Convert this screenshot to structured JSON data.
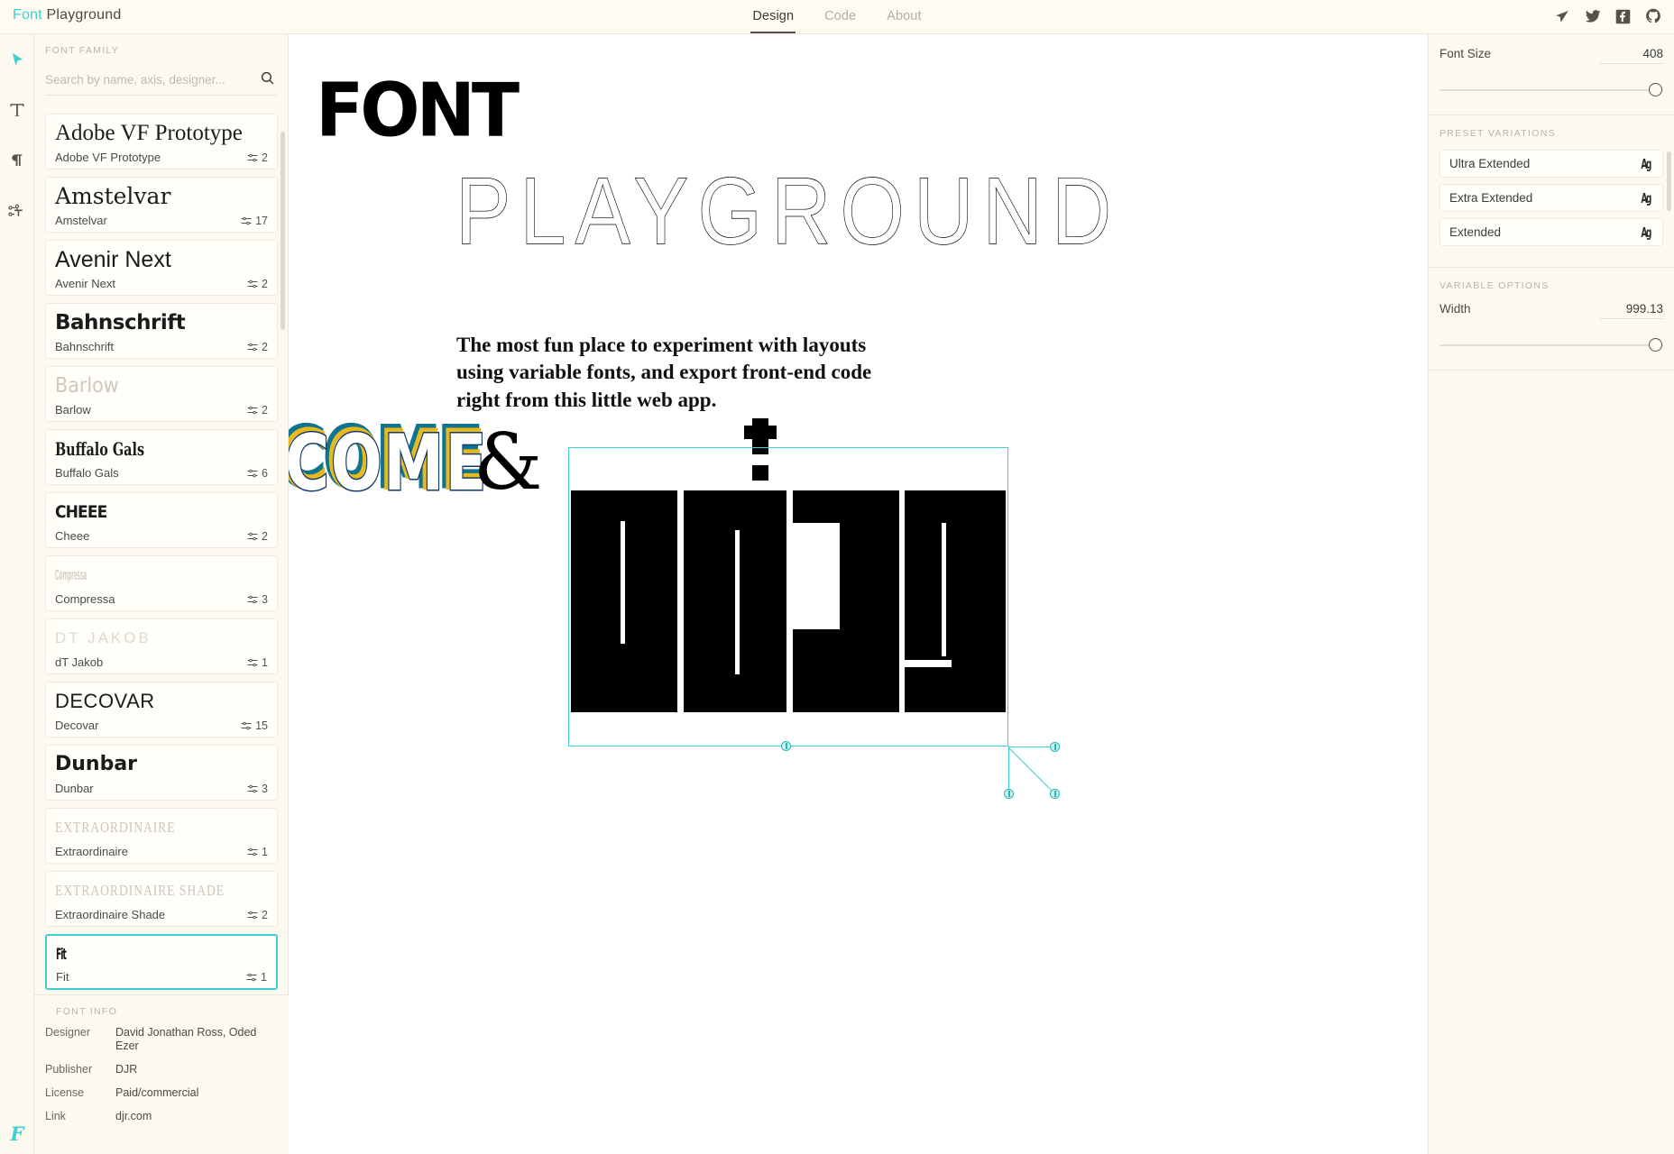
{
  "app": {
    "brand_accent": "Font",
    "brand_rest": " Playground",
    "accent_color": "#3ecfcf",
    "logo_letter": "F"
  },
  "header": {
    "tabs": [
      {
        "label": "Design",
        "active": true
      },
      {
        "label": "Code",
        "active": false
      },
      {
        "label": "About",
        "active": false
      }
    ],
    "icons": [
      "cursor-icon",
      "twitter-icon",
      "facebook-icon",
      "github-icon"
    ]
  },
  "toolrail": {
    "tools": [
      {
        "name": "select-tool",
        "icon": "cursor-icon",
        "active": true
      },
      {
        "name": "text-tool",
        "icon": "text-t-icon",
        "active": false
      },
      {
        "name": "paragraph-tool",
        "icon": "pilcrow-icon",
        "active": false
      },
      {
        "name": "glyph-node-tool",
        "icon": "glyph-nodes-icon",
        "active": false
      }
    ]
  },
  "sidebar": {
    "caption": "FONT FAMILY",
    "search": {
      "placeholder": "Search by name, axis, designer...",
      "value": ""
    },
    "fonts": [
      {
        "preview": "Adobe VF Prototype",
        "name": "Adobe VF Prototype",
        "axes": "2",
        "style": "pv-serif",
        "selected": false
      },
      {
        "preview": "Amstelvar",
        "name": "Amstelvar",
        "axes": "17",
        "style": "pv-serif2",
        "selected": false
      },
      {
        "preview": "Avenir Next",
        "name": "Avenir Next",
        "axes": "2",
        "style": "pv-sans",
        "selected": false
      },
      {
        "preview": "Bahnschrift",
        "name": "Bahnschrift",
        "axes": "2",
        "style": "pv-bold",
        "selected": false
      },
      {
        "preview": "Barlow",
        "name": "Barlow",
        "axes": "2",
        "style": "pv-light",
        "selected": false
      },
      {
        "preview": "Buffalo Gals",
        "name": "Buffalo Gals",
        "axes": "6",
        "style": "pv-slab",
        "selected": false
      },
      {
        "preview": "CHEEE",
        "name": "Cheee",
        "axes": "2",
        "style": "pv-cheee",
        "selected": false
      },
      {
        "preview": "Compressa",
        "name": "Compressa",
        "axes": "3",
        "style": "pv-compr",
        "selected": false
      },
      {
        "preview": "DT JAKOB",
        "name": "dT Jakob",
        "axes": "1",
        "style": "pv-jakob",
        "selected": false
      },
      {
        "preview": "DECOVAR",
        "name": "Decovar",
        "axes": "15",
        "style": "pv-deco",
        "selected": false
      },
      {
        "preview": "Dunbar",
        "name": "Dunbar",
        "axes": "3",
        "style": "pv-dunbar",
        "selected": false
      },
      {
        "preview": "EXTRAORDINAIRE",
        "name": "Extraordinaire",
        "axes": "1",
        "style": "pv-extra",
        "selected": false
      },
      {
        "preview": "EXTRAORDINAIRE SHADE",
        "name": "Extraordinaire Shade",
        "axes": "2",
        "style": "pv-extra",
        "selected": false
      },
      {
        "preview": "Fit",
        "name": "Fit",
        "axes": "1",
        "style": "pv-fit",
        "selected": true
      }
    ]
  },
  "font_info": {
    "caption": "FONT INFO",
    "rows": [
      {
        "label": "Designer",
        "value": "David Jonathan Ross, Oded Ezer"
      },
      {
        "label": "Publisher",
        "value": "DJR"
      },
      {
        "label": "License",
        "value": "Paid/commercial"
      },
      {
        "label": "Link",
        "value": "djr.com"
      }
    ]
  },
  "canvas": {
    "hero_word": "FONT",
    "hero_subword": "PLAYGROUND",
    "description": "The most fun place to experiment with layouts using variable fonts, and export front-end code right from this little web app.",
    "come_word": "COME",
    "ampersand": "&",
    "play_word": "play!",
    "come_colors": {
      "outer": "#0e7490",
      "middle": "#e8b81f",
      "inner": "#123a6b"
    },
    "selection_color": "#3ecfcf"
  },
  "right_panel": {
    "font_size": {
      "label": "Font Size",
      "value": "408"
    },
    "presets_caption": "PRESET VARIATIONS",
    "presets": [
      {
        "label": "Ultra Extended",
        "glyph": "Ag"
      },
      {
        "label": "Extra Extended",
        "glyph": "Ag"
      },
      {
        "label": "Extended",
        "glyph": "Ag"
      }
    ],
    "variable_caption": "VARIABLE OPTIONS",
    "width": {
      "label": "Width",
      "value": "999.13"
    }
  }
}
